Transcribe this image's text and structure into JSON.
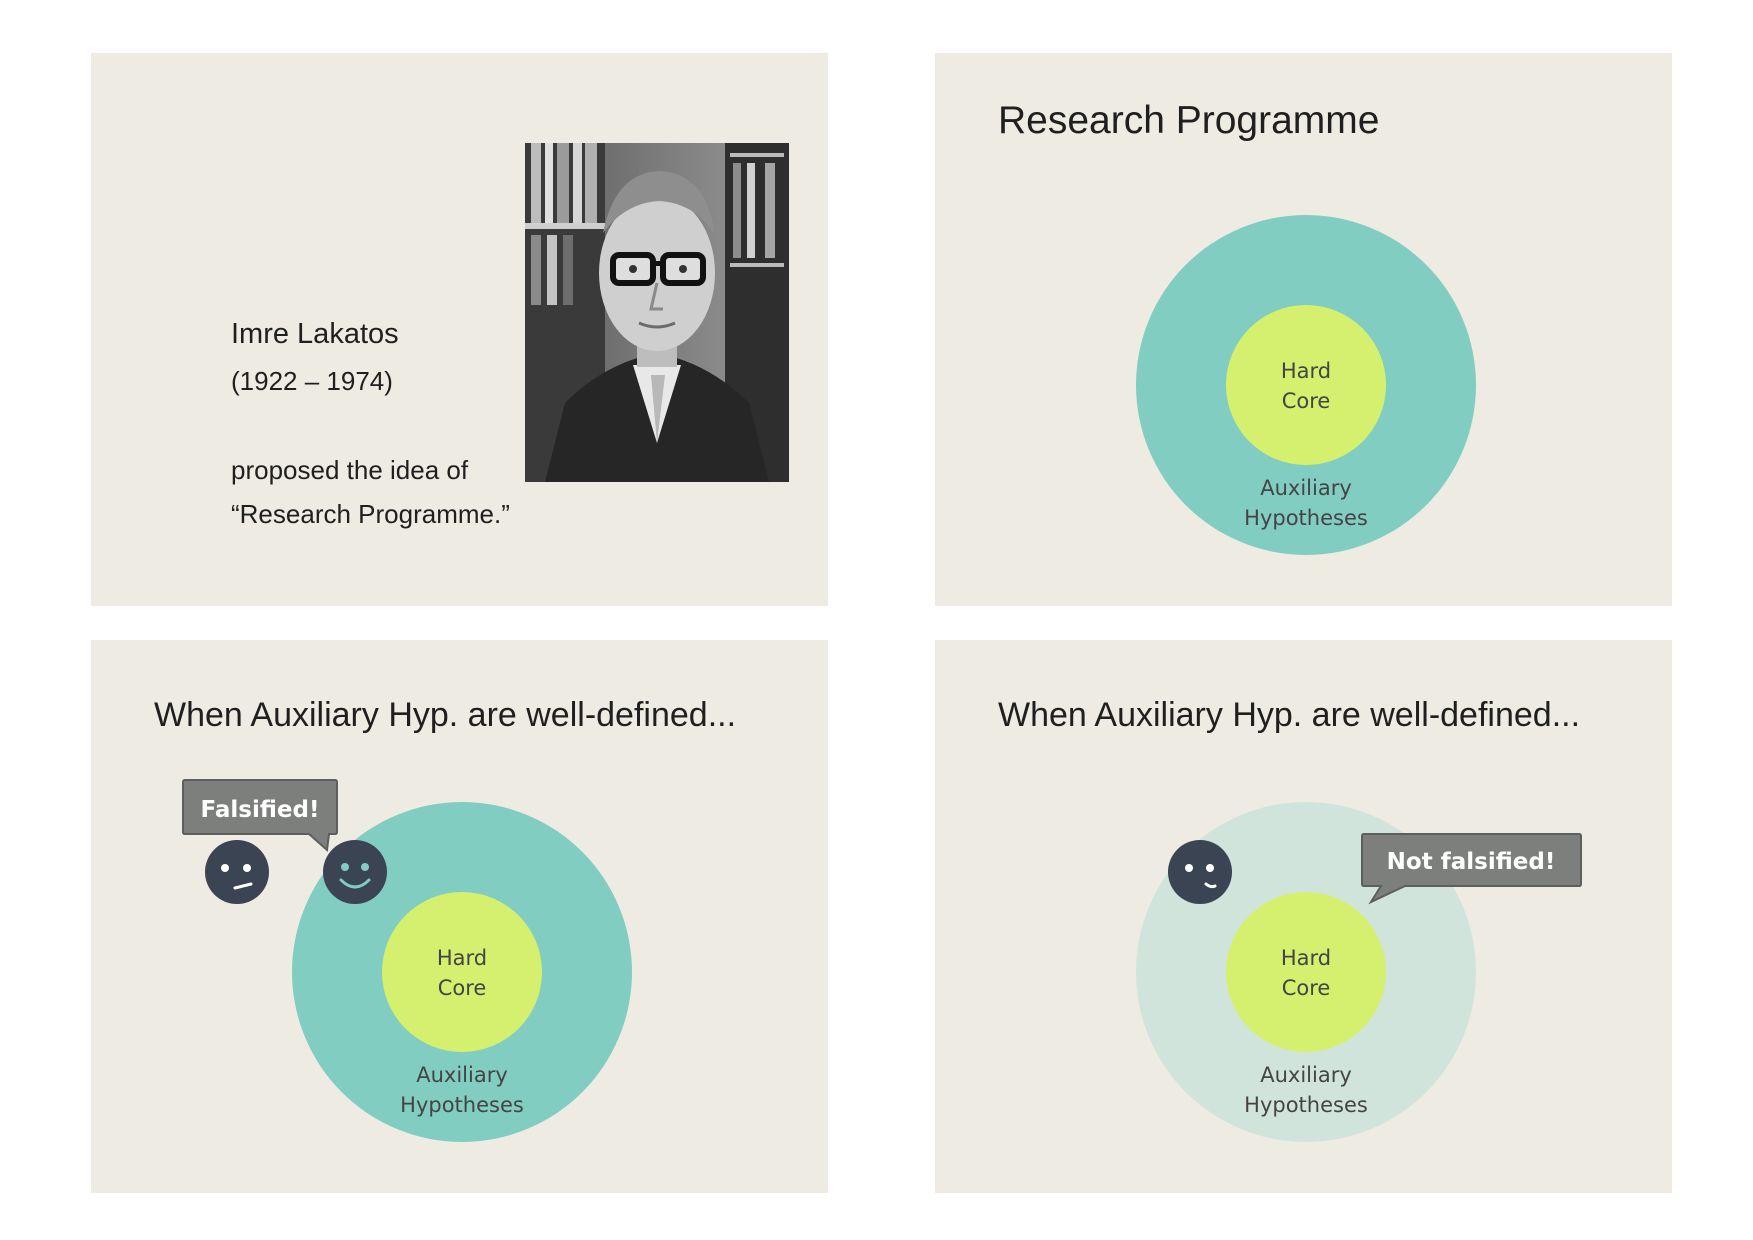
{
  "slides": [
    {
      "person": {
        "name": "Imre Lakatos",
        "years": "(1922 – 1974)",
        "line1": "proposed the idea of",
        "line2": "“Research Programme.”"
      }
    },
    {
      "title": "Research Programme",
      "diagram": {
        "inner_line1": "Hard",
        "inner_line2": "Core",
        "outer_line1": "Auxiliary",
        "outer_line2": "Hypotheses"
      }
    },
    {
      "title": "When Auxiliary Hyp. are well-defined...",
      "diagram": {
        "inner_line1": "Hard",
        "inner_line2": "Core",
        "outer_line1": "Auxiliary",
        "outer_line2": "Hypotheses"
      },
      "bubble": "Falsified!"
    },
    {
      "title": "When Auxiliary Hyp. are well-defined...",
      "diagram": {
        "inner_line1": "Hard",
        "inner_line2": "Core",
        "outer_line1": "Auxiliary",
        "outer_line2": "Hypotheses"
      },
      "bubble": "Not falsified!"
    }
  ],
  "colors": {
    "slide_bg": "#eeebe3",
    "outer_circle": "#82cdc2",
    "outer_circle_faded": "#d0e4dc",
    "inner_circle": "#d4f06e",
    "face": "#3b4452",
    "bubble": "#7d7f7c"
  },
  "icons": [
    "neutral-face-icon",
    "smiling-face-icon",
    "speech-bubble-icon",
    "portrait-photo"
  ]
}
